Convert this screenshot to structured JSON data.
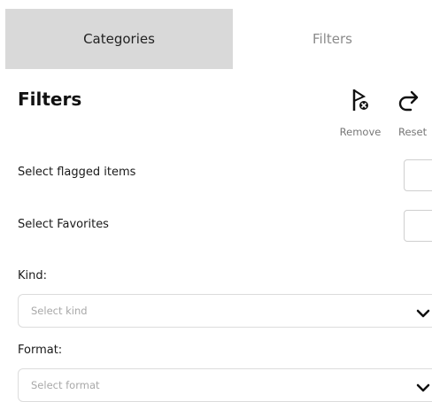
{
  "tabs": {
    "categories": "Categories",
    "filters": "Filters"
  },
  "header": {
    "title": "Filters"
  },
  "toolbar": {
    "remove_label": "Remove",
    "remove_icon": "flag-remove-icon",
    "reset_label": "Reset",
    "reset_icon": "reset-arrow-icon"
  },
  "options": {
    "flagged_label": "Select flagged items",
    "favorites_label": "Select Favorites"
  },
  "kind": {
    "label": "Kind:",
    "placeholder": "Select kind"
  },
  "format": {
    "label": "Format:",
    "placeholder": "Select format"
  },
  "colors": {
    "active_tab_bg": "#d9d9d9",
    "inactive_tab_text": "#8a8a8a",
    "muted_text": "#777777"
  }
}
